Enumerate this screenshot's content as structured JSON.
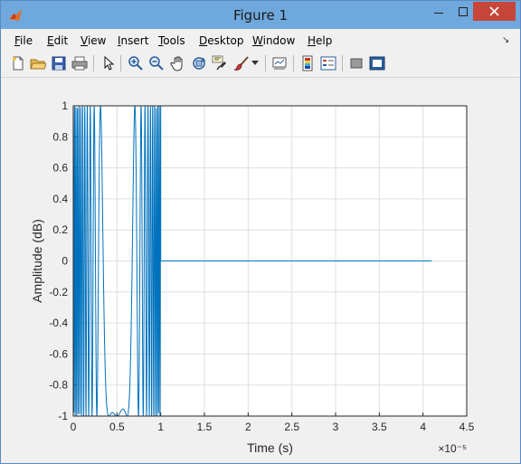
{
  "window": {
    "title": "Figure 1"
  },
  "menu": [
    {
      "label": "File",
      "acc": "F",
      "rest": "ile"
    },
    {
      "label": "Edit",
      "acc": "E",
      "rest": "dit"
    },
    {
      "label": "View",
      "acc": "V",
      "rest": "iew"
    },
    {
      "label": "Insert",
      "acc": "I",
      "rest": "nsert"
    },
    {
      "label": "Tools",
      "acc": "T",
      "rest": "ools"
    },
    {
      "label": "Desktop",
      "acc": "D",
      "rest": "esktop"
    },
    {
      "label": "Window",
      "acc": "W",
      "rest": "indow"
    },
    {
      "label": "Help",
      "acc": "H",
      "rest": "elp"
    }
  ],
  "toolbar": [
    "new-figure-icon",
    "open-file-icon",
    "save-icon",
    "print-icon",
    "edit-plot-arrow-icon",
    "zoom-in-icon",
    "zoom-out-icon",
    "pan-hand-icon",
    "rotate-3d-icon",
    "data-cursor-icon",
    "brush-icon",
    "brush-dropdown-icon",
    "link-plot-icon",
    "insert-colorbar-icon",
    "insert-legend-icon",
    "hide-plot-tools-icon",
    "show-plot-tools-icon"
  ],
  "chart_data": {
    "type": "line",
    "xlabel": "Time (s)",
    "ylabel": "Amplitude (dB)",
    "x_exponent": "×10⁻⁵",
    "xlim": [
      0,
      4.5
    ],
    "ylim": [
      -1,
      1
    ],
    "xticks": [
      "0",
      "0.5",
      "1",
      "1.5",
      "2",
      "2.5",
      "3",
      "3.5",
      "4",
      "4.5"
    ],
    "yticks": [
      "1",
      "0.8",
      "0.6",
      "0.4",
      "0.2",
      "0",
      "-0.2",
      "-0.4",
      "-0.6",
      "-0.8",
      "-1"
    ],
    "grid": true,
    "series": [
      {
        "color": "#0072bd",
        "description_points": {
          "chirp_interval_x": [
            0,
            1.0
          ],
          "flat_interval_x": [
            1.0,
            4.1
          ],
          "flat_value": 0
        }
      }
    ]
  }
}
